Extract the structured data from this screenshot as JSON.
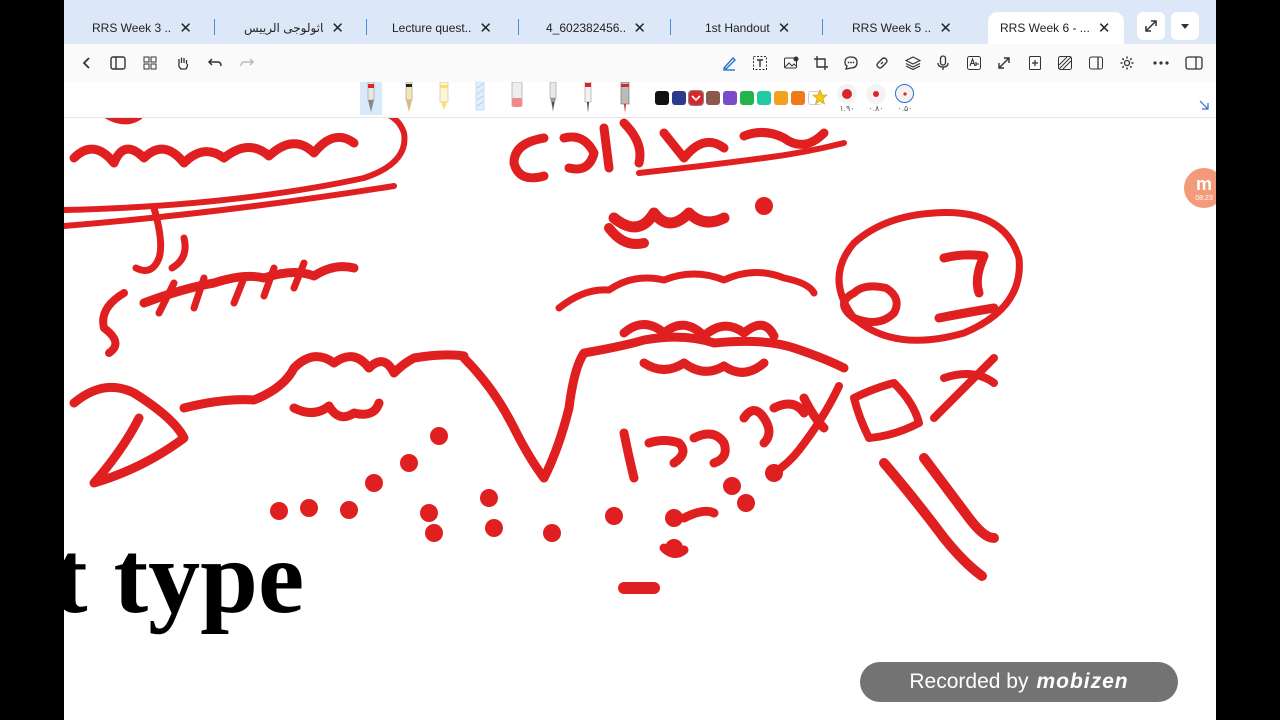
{
  "tabs": [
    {
      "label": "RRS Week 3 ...",
      "active": false
    },
    {
      "label": "باثولوجى الرييس...",
      "active": false
    },
    {
      "label": "Lecture quest...",
      "active": false
    },
    {
      "label": "4_602382456...",
      "active": false
    },
    {
      "label": "1st Handout",
      "active": false
    },
    {
      "label": "RRS Week 5 ...",
      "active": false
    },
    {
      "label": "RRS Week 6 - ...",
      "active": true
    }
  ],
  "tab_close_glyph": "✕",
  "tabbar_buttons": {
    "expand_icon": "expand-icon",
    "dropdown_icon": "chevron-down-icon"
  },
  "pen_colors": [
    "#111111",
    "#2b3a8c",
    "#d8262a",
    "#8b5a4a",
    "#7a4bc9",
    "#22b44a",
    "#23c9a0",
    "#f2a21b",
    "#f07a1a",
    "#ffffff"
  ],
  "selected_color": "#d8262a",
  "size_labels": [
    "۱.۹۰",
    "۰.۸۰",
    "۰.۵۰"
  ],
  "document": {
    "visible_text": "lt type"
  },
  "recorder_badge": {
    "prefix": "Recorded by",
    "brand": "mobizen"
  },
  "floating_bubble": {
    "letter": "m",
    "time": "08:23"
  },
  "accent_color": "#3d8fd9",
  "ink_color": "#e02020"
}
